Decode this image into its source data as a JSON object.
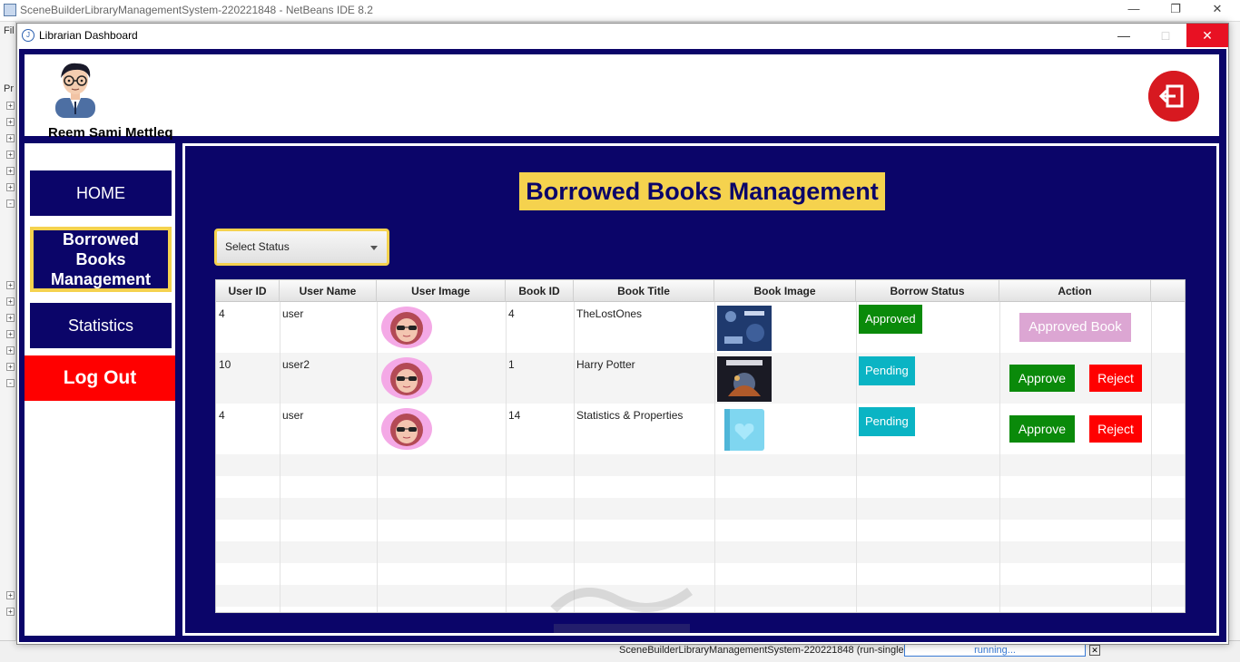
{
  "ide": {
    "title": "SceneBuilderLibraryManagementSystem-220221848 - NetBeans IDE 8.2",
    "left_label_1": "Fil",
    "left_label_2": "Pr",
    "status_text": "SceneBuilderLibraryManagementSystem-220221848 (run-single)",
    "progress_text": "running..."
  },
  "window": {
    "title": "Librarian Dashboard"
  },
  "header": {
    "user_name": "Reem Sami Mettleq"
  },
  "sidebar": {
    "home": "HOME",
    "borrowed": "Borrowed Books Management",
    "statistics": "Statistics",
    "logout": "Log Out"
  },
  "main": {
    "title": "Borrowed Books Management",
    "status_placeholder": "Select Status"
  },
  "table": {
    "columns": [
      "User ID",
      "User Name",
      "User Image",
      "Book ID",
      "Book Title",
      "Book Image",
      "Borrow Status",
      "Action"
    ],
    "rows": [
      {
        "user_id": "4",
        "user_name": "user",
        "book_id": "4",
        "book_title": "TheLostOnes",
        "status": "Approved",
        "action": "Approved Book"
      },
      {
        "user_id": "10",
        "user_name": "user2",
        "book_id": "1",
        "book_title": "Harry Potter",
        "status": "Pending",
        "approve": "Approve",
        "reject": "Reject"
      },
      {
        "user_id": "4",
        "user_name": "user",
        "book_id": "14",
        "book_title": "Statistics & Properties",
        "status": "Pending",
        "approve": "Approve",
        "reject": "Reject"
      }
    ]
  },
  "colors": {
    "navy": "#0b0569",
    "yellow": "#f5d24e",
    "red": "#ff0000",
    "green": "#0a8a0a",
    "teal": "#0ab4c4",
    "pink": "#dca6d3"
  },
  "icons": {
    "exit": "exit-icon",
    "avatar": "avatar-icon"
  }
}
